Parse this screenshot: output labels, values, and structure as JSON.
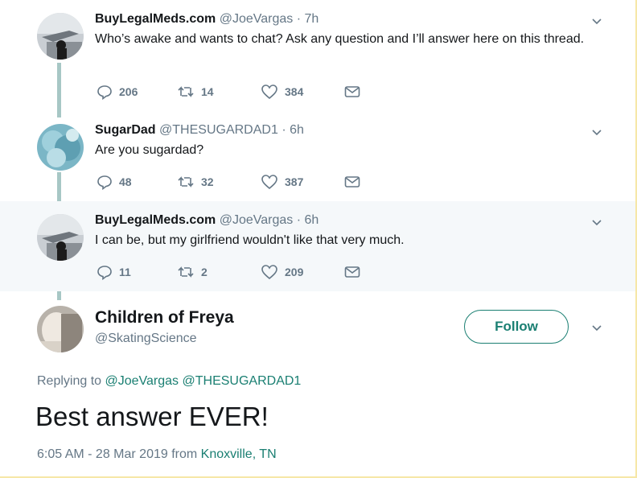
{
  "tweets": [
    {
      "name": "BuyLegalMeds.com",
      "handle": "@JoeVargas",
      "time": "· 7h",
      "text": "Who’s awake and wants to chat? Ask any question and I’ll answer here on this thread.",
      "replies": "206",
      "retweets": "14",
      "likes": "384"
    },
    {
      "name": "SugarDad",
      "handle": "@THESUGARDAD1",
      "time": "· 6h",
      "text": "Are you sugardad?",
      "replies": "48",
      "retweets": "32",
      "likes": "387"
    },
    {
      "name": "BuyLegalMeds.com",
      "handle": "@JoeVargas",
      "time": "· 6h",
      "text": "I can be, but my girlfriend wouldn't like that very much.",
      "replies": "11",
      "retweets": "2",
      "likes": "209"
    }
  ],
  "main": {
    "name": "Children of Freya",
    "handle": "@SkatingScience",
    "follow_label": "Follow",
    "replying_prefix": "Replying to",
    "replying_to_1": "@JoeVargas",
    "replying_to_2": "@THESUGARDAD1",
    "text": "Best answer EVER!",
    "timestamp": "6:05 AM - 28 Mar 2019 from",
    "location": "Knoxville, TN"
  },
  "icons": {
    "reply": "reply-icon",
    "retweet": "retweet-icon",
    "like": "heart-icon",
    "dm": "envelope-icon",
    "caret": "chevron-down-icon"
  },
  "colors": {
    "accent": "#1a7f72",
    "thread_line": "#a7c7c5",
    "muted_text": "#657786",
    "highlight_bg": "#f5f8fa"
  }
}
